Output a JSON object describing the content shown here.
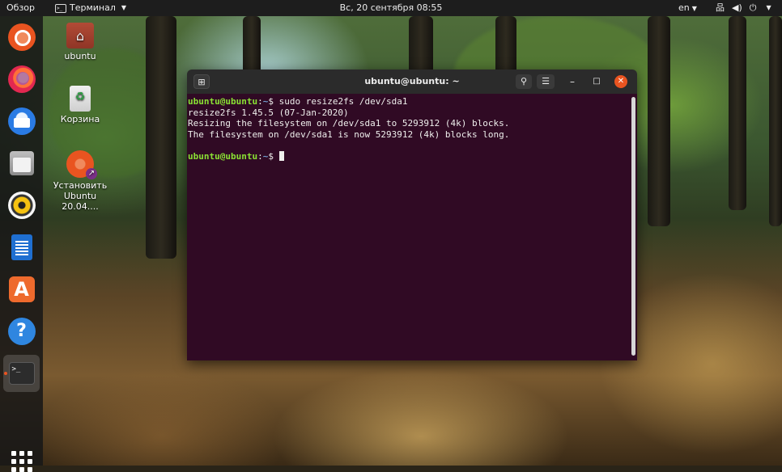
{
  "topbar": {
    "overview": "Обзор",
    "app_menu": "Терминал",
    "clock": "Вс, 20 сентября  08:55",
    "language": "en"
  },
  "dock": {
    "items": [
      {
        "name": "ubuntu-installer"
      },
      {
        "name": "firefox"
      },
      {
        "name": "thunderbird"
      },
      {
        "name": "files"
      },
      {
        "name": "rhythmbox"
      },
      {
        "name": "libreoffice-writer"
      },
      {
        "name": "ubuntu-software"
      },
      {
        "name": "help"
      },
      {
        "name": "terminal",
        "active": true
      }
    ]
  },
  "desktop": {
    "icons": [
      {
        "label": "ubuntu"
      },
      {
        "label": "Корзина"
      },
      {
        "label": "Установить Ubuntu 20.04...."
      }
    ]
  },
  "terminal": {
    "title": "ubuntu@ubuntu: ~",
    "prompt_user": "ubuntu@ubuntu",
    "prompt_path": "~",
    "command": "sudo resize2fs /dev/sda1",
    "output": [
      "resize2fs 1.45.5 (07-Jan-2020)",
      "Resizing the filesystem on /dev/sda1 to 5293912 (4k) blocks.",
      "The filesystem on /dev/sda1 is now 5293912 (4k) blocks long."
    ]
  },
  "colors": {
    "accent": "#e95420",
    "terminal_bg": "#300a24",
    "prompt_user": "#8ae234",
    "prompt_path": "#729fcf"
  }
}
